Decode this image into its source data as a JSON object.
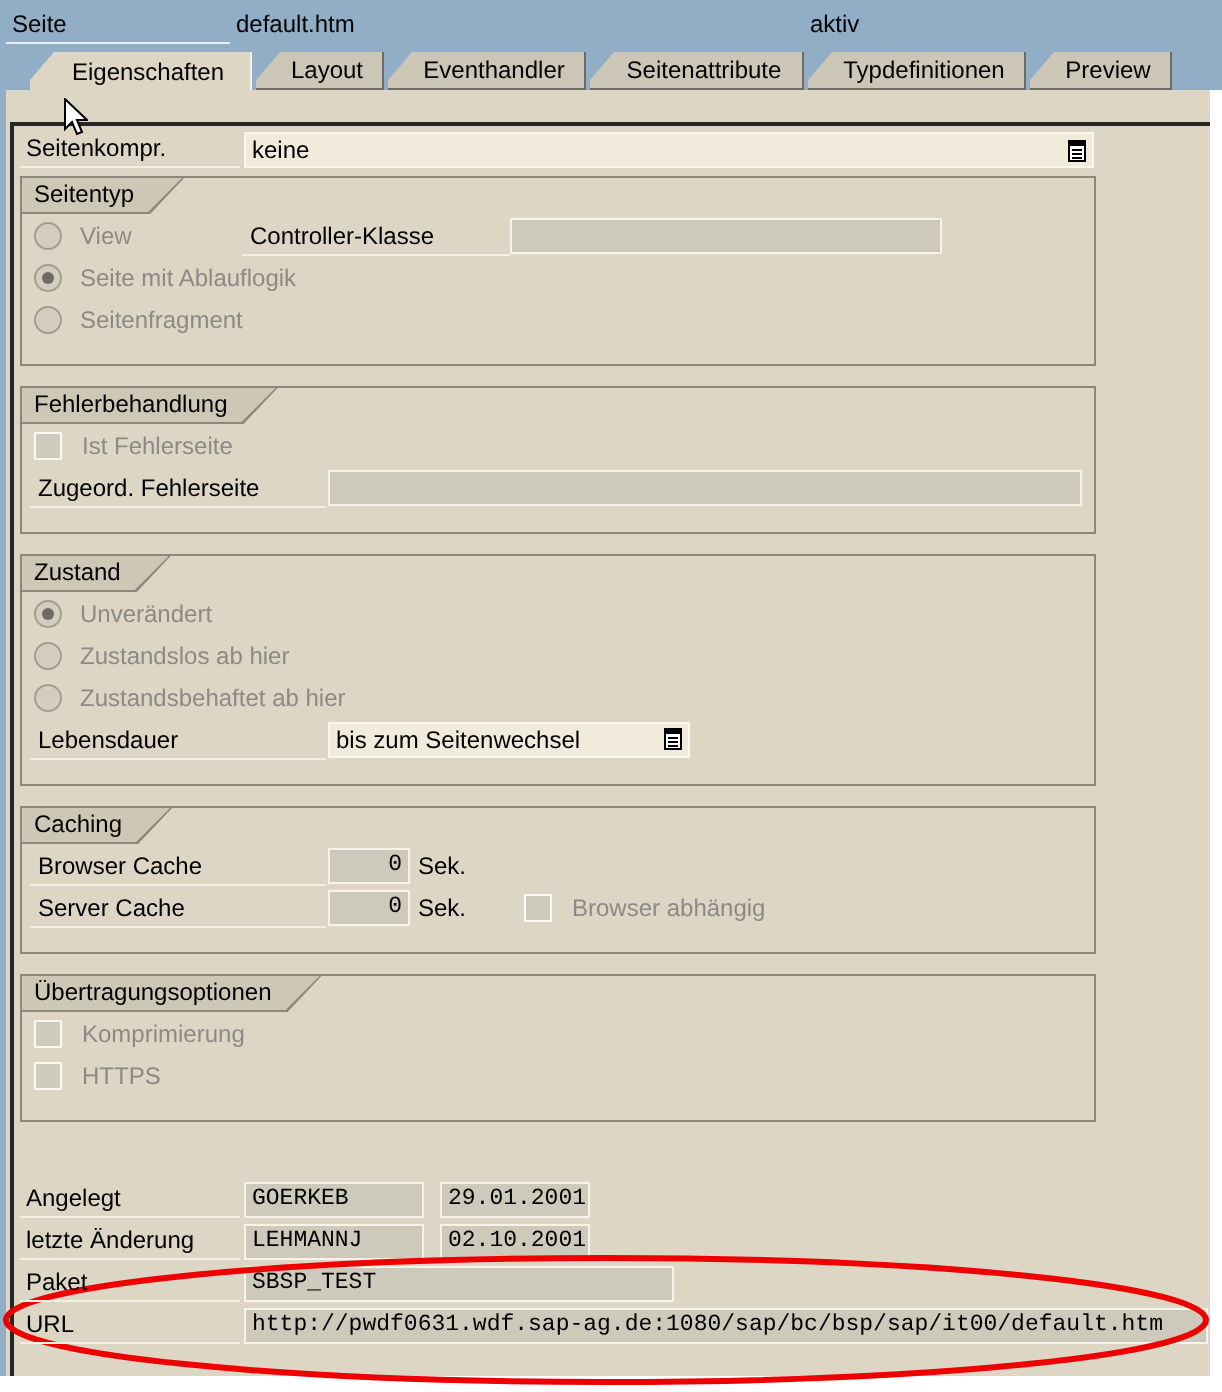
{
  "header": {
    "label": "Seite",
    "value": "default.htm",
    "status": "aktiv"
  },
  "tabs": [
    {
      "label": "Eigenschaften",
      "selected": true
    },
    {
      "label": "Layout",
      "selected": false
    },
    {
      "label": "Eventhandler",
      "selected": false
    },
    {
      "label": "Seitenattribute",
      "selected": false
    },
    {
      "label": "Typdefinitionen",
      "selected": false
    },
    {
      "label": "Preview",
      "selected": false
    }
  ],
  "page_compression": {
    "label": "Seitenkompr.",
    "value": "keine"
  },
  "groups": [
    {
      "title": "Seitentyp",
      "rows": [
        {
          "kind": "radio",
          "label": "View",
          "selected": false,
          "disabled": true,
          "field_label": "Controller-Klasse"
        },
        {
          "kind": "radio",
          "label": "Seite mit Ablauflogik",
          "selected": true,
          "disabled": true
        },
        {
          "kind": "radio",
          "label": "Seitenfragment",
          "selected": false,
          "disabled": true
        }
      ]
    },
    {
      "title": "Fehlerbehandlung",
      "rows": [
        {
          "kind": "checkbox",
          "label": "Ist Fehlerseite",
          "checked": false,
          "disabled": true
        },
        {
          "kind": "field",
          "label": "Zugeord. Fehlerseite"
        }
      ]
    },
    {
      "title": "Zustand",
      "rows": [
        {
          "kind": "radio",
          "label": "Unverändert",
          "selected": true,
          "disabled": true
        },
        {
          "kind": "radio",
          "label": "Zustandslos ab hier",
          "selected": false,
          "disabled": true
        },
        {
          "kind": "radio",
          "label": "Zustandsbehaftet ab hier",
          "selected": false,
          "disabled": true
        },
        {
          "kind": "dropdown",
          "label": "Lebensdauer",
          "value": "bis zum Seitenwechsel"
        }
      ]
    },
    {
      "title": "Caching",
      "rows": [
        {
          "kind": "field",
          "label": "Browser Cache",
          "value": "0",
          "unit": "Sek."
        },
        {
          "kind": "field",
          "label": "Server Cache",
          "value": "0",
          "unit": "Sek.",
          "checkbox": {
            "label": "Browser abhängig",
            "checked": false,
            "disabled": true
          }
        }
      ]
    },
    {
      "title": "Übertragungsoptionen",
      "rows": [
        {
          "kind": "checkbox",
          "label": "Komprimierung",
          "checked": false,
          "disabled": true
        },
        {
          "kind": "checkbox",
          "label": "HTTPS",
          "checked": false,
          "disabled": true
        }
      ]
    }
  ],
  "info": [
    {
      "kind": "audit",
      "label": "Angelegt",
      "values": [
        "GOERKEB",
        "29.01.2001"
      ]
    },
    {
      "kind": "audit",
      "label": "letzte Änderung",
      "values": [
        "LEHMANNJ",
        "02.10.2001"
      ]
    },
    {
      "kind": "package",
      "label": "Paket",
      "values": [
        "SBSP_TEST"
      ]
    },
    {
      "kind": "url",
      "label": "URL",
      "values": [
        "http://pwdf0631.wdf.sap-ag.de:1080/sap/bc/bsp/sap/it00/default.htm"
      ]
    }
  ],
  "annotation": {
    "kind": "ellipse"
  }
}
